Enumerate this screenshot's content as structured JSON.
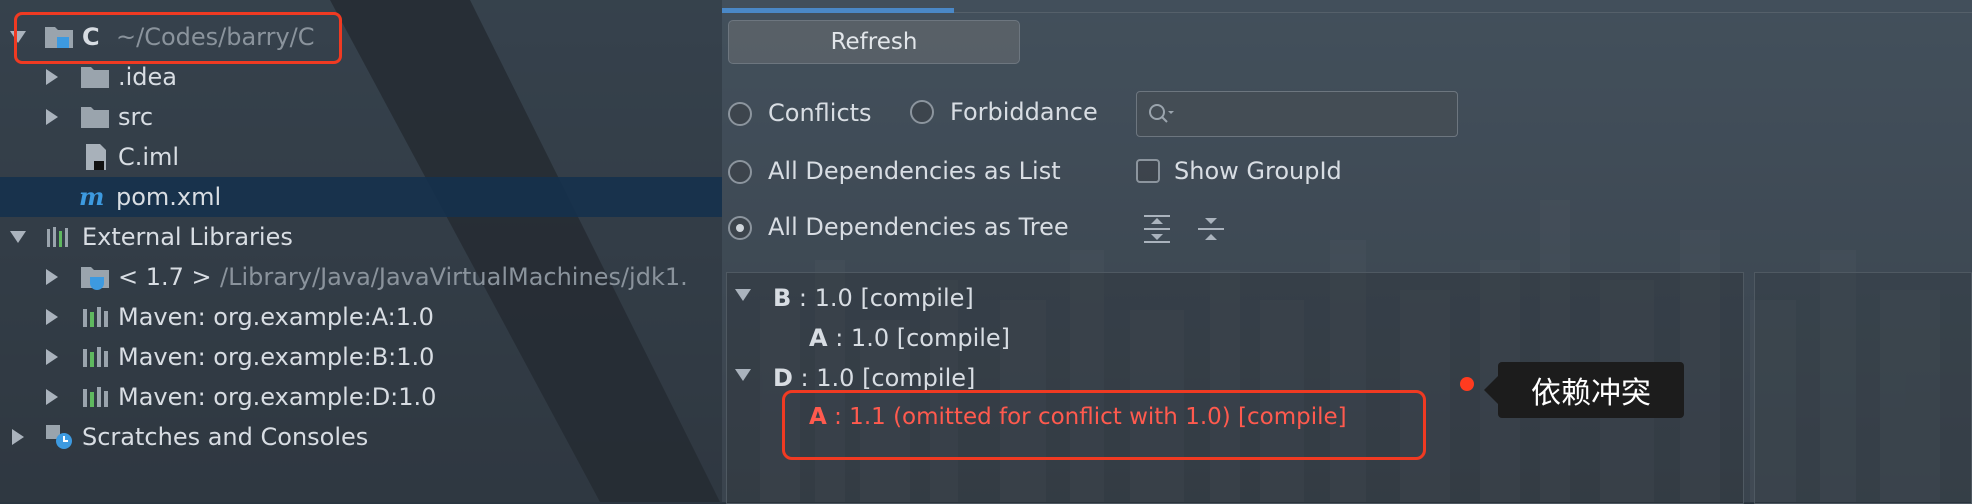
{
  "project_tree": {
    "root": {
      "name": "C",
      "path": "~/Codes/barry/C"
    },
    "items": [
      {
        "label": ".idea",
        "icon": "folder-icon"
      },
      {
        "label": "src",
        "icon": "folder-icon"
      },
      {
        "label": "C.iml",
        "icon": "iml-file-icon"
      },
      {
        "label": "pom.xml",
        "icon": "maven-file-icon"
      },
      {
        "label": "External Libraries",
        "icon": "libraries-icon"
      },
      {
        "label": "< 1.7 >",
        "path": "/Library/Java/JavaVirtualMachines/jdk1.",
        "icon": "jdk-icon"
      },
      {
        "label": "Maven: org.example:A:1.0",
        "icon": "library-icon"
      },
      {
        "label": "Maven: org.example:B:1.0",
        "icon": "library-icon"
      },
      {
        "label": "Maven: org.example:D:1.0",
        "icon": "library-icon"
      },
      {
        "label": "Scratches and Consoles",
        "icon": "scratches-icon"
      }
    ]
  },
  "toolbar": {
    "refresh_label": "Refresh"
  },
  "filters": {
    "conflicts_label": "Conflicts",
    "forbiddance_label": "Forbiddance",
    "all_list_label": "All Dependencies as List",
    "show_groupid_label": "Show GroupId",
    "all_tree_label": "All Dependencies as Tree",
    "selected_view": "All Dependencies as Tree",
    "search_placeholder": ""
  },
  "dependency_tree": [
    {
      "name": "B",
      "rest": " : 1.0 [compile]"
    },
    {
      "name": "A",
      "rest": " : 1.0 [compile]"
    },
    {
      "name": "D",
      "rest": " : 1.0 [compile]"
    },
    {
      "name": "A",
      "rest": " : 1.1 (omitted for conflict with 1.0) [compile]"
    }
  ],
  "annotation": {
    "tooltip_text": "依赖冲突"
  },
  "colors": {
    "accent_tab": "#4a88c7",
    "highlight": "#f03a22",
    "conflict_text": "#ff5a4e",
    "selection": "#14304e"
  }
}
